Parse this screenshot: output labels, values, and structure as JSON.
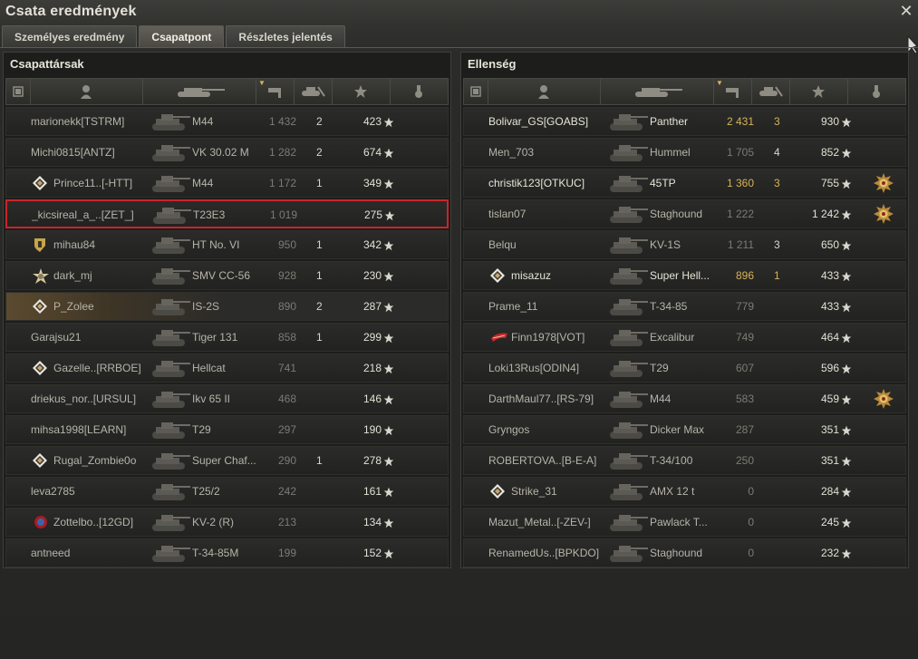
{
  "window": {
    "title": "Csata eredmények",
    "close_icon": "close-icon"
  },
  "tabs": [
    {
      "label": "Személyes eredmény",
      "active": false
    },
    {
      "label": "Csapatpont",
      "active": true
    },
    {
      "label": "Részletes jelentés",
      "active": false
    }
  ],
  "columns": [
    "squad-icon",
    "player-icon",
    "tank-icon",
    "xp-flag-icon",
    "kills-tank-icon",
    "star-icon",
    "medal-icon"
  ],
  "allies": {
    "title": "Csapattársak",
    "rows": [
      {
        "name": "marionekk[TSTRM]",
        "tank": "M44",
        "xp": "1 432",
        "kills": "2",
        "damage": "423",
        "badge": null,
        "medal": false
      },
      {
        "name": "Michi0815[ANTZ]",
        "tank": "VK 30.02 M",
        "xp": "1 282",
        "kills": "2",
        "damage": "674",
        "badge": null,
        "medal": false
      },
      {
        "name": "Prince11..[-HTT]",
        "tank": "M44",
        "xp": "1 172",
        "kills": "1",
        "damage": "349",
        "badge": "diamond",
        "medal": false
      },
      {
        "name": "_kicsireal_a_..[ZET_]",
        "tank": "T23E3",
        "xp": "1 019",
        "kills": "",
        "damage": "275",
        "badge": null,
        "medal": false,
        "highlight": true
      },
      {
        "name": "mihau84",
        "tank": "HT No. VI",
        "xp": "950",
        "kills": "1",
        "damage": "342",
        "badge": "shield",
        "medal": false
      },
      {
        "name": "dark_mj",
        "tank": "SMV CC-56",
        "xp": "928",
        "kills": "1",
        "damage": "230",
        "badge": "star-burst",
        "medal": false
      },
      {
        "name": "P_Zolee",
        "tank": "IS-2S",
        "xp": "890",
        "kills": "2",
        "damage": "287",
        "badge": "diamond",
        "medal": false,
        "squad": true
      },
      {
        "name": "Garajsu21",
        "tank": "Tiger 131",
        "xp": "858",
        "kills": "1",
        "damage": "299",
        "badge": null,
        "medal": false
      },
      {
        "name": "Gazelle..[RRBOE]",
        "tank": "Hellcat",
        "xp": "741",
        "kills": "",
        "damage": "218",
        "badge": "diamond",
        "medal": false
      },
      {
        "name": "driekus_nor..[URSUL]",
        "tank": "Ikv 65 II",
        "xp": "468",
        "kills": "",
        "damage": "146",
        "badge": null,
        "medal": false
      },
      {
        "name": "mihsa1998[LEARN]",
        "tank": "T29",
        "xp": "297",
        "kills": "",
        "damage": "190",
        "badge": null,
        "medal": false
      },
      {
        "name": "Rugal_Zombie0o",
        "tank": "Super Chaf...",
        "xp": "290",
        "kills": "1",
        "damage": "278",
        "badge": "diamond",
        "medal": false
      },
      {
        "name": "leva2785",
        "tank": "T25/2",
        "xp": "242",
        "kills": "",
        "damage": "161",
        "badge": null,
        "medal": false
      },
      {
        "name": "Zottelbo..[12GD]",
        "tank": "KV-2 (R)",
        "xp": "213",
        "kills": "",
        "damage": "134",
        "badge": "clan-red",
        "medal": false
      },
      {
        "name": "antneed",
        "tank": "T-34-85M",
        "xp": "199",
        "kills": "",
        "damage": "152",
        "badge": null,
        "medal": false
      }
    ]
  },
  "enemies": {
    "title": "Ellenség",
    "rows": [
      {
        "name": "Bolivar_GS[GOABS]",
        "tank": "Panther",
        "xp": "2 431",
        "kills": "3",
        "damage": "930",
        "badge": null,
        "medal": false,
        "bold": true
      },
      {
        "name": "Men_703",
        "tank": "Hummel",
        "xp": "1 705",
        "kills": "4",
        "damage": "852",
        "badge": null,
        "medal": false
      },
      {
        "name": "christik123[OTKUC]",
        "tank": "45TP",
        "xp": "1 360",
        "kills": "3",
        "damage": "755",
        "badge": null,
        "medal": true,
        "bold": true
      },
      {
        "name": "tislan07",
        "tank": "Staghound",
        "xp": "1 222",
        "kills": "",
        "damage": "1 242",
        "badge": null,
        "medal": true
      },
      {
        "name": "Belqu",
        "tank": "KV-1S",
        "xp": "1 211",
        "kills": "3",
        "damage": "650",
        "badge": null,
        "medal": false
      },
      {
        "name": "misazuz",
        "tank": "Super Hell...",
        "xp": "896",
        "kills": "1",
        "damage": "433",
        "badge": "diamond",
        "medal": false,
        "bold": true
      },
      {
        "name": "Prame_11",
        "tank": "T-34-85",
        "xp": "779",
        "kills": "",
        "damage": "433",
        "badge": null,
        "medal": false
      },
      {
        "name": "Finn1978[VOT]",
        "tank": "Excalibur",
        "xp": "749",
        "kills": "",
        "damage": "464",
        "badge": "clan-flag",
        "medal": false
      },
      {
        "name": "Loki13Rus[ODIN4]",
        "tank": "T29",
        "xp": "607",
        "kills": "",
        "damage": "596",
        "badge": null,
        "medal": false
      },
      {
        "name": "DarthMaul77..[RS-79]",
        "tank": "M44",
        "xp": "583",
        "kills": "",
        "damage": "459",
        "badge": null,
        "medal": true
      },
      {
        "name": "Gryngos",
        "tank": "Dicker Max",
        "xp": "287",
        "kills": "",
        "damage": "351",
        "badge": null,
        "medal": false
      },
      {
        "name": "ROBERTOVA..[B-E-A]",
        "tank": "T-34/100",
        "xp": "250",
        "kills": "",
        "damage": "351",
        "badge": null,
        "medal": false
      },
      {
        "name": "Strike_31",
        "tank": "AMX 12 t",
        "xp": "0",
        "kills": "",
        "damage": "284",
        "badge": "diamond",
        "medal": false
      },
      {
        "name": "Mazut_Metal..[-ZEV-]",
        "tank": "Pawlack T...",
        "xp": "0",
        "kills": "",
        "damage": "245",
        "badge": null,
        "medal": false
      },
      {
        "name": "RenamedUs..[BPKDO]",
        "tank": "Staghound",
        "xp": "0",
        "kills": "",
        "damage": "232",
        "badge": null,
        "medal": false
      }
    ]
  },
  "colors": {
    "highlight_border": "#c8252a",
    "gold_text": "#d8b25a",
    "panel_bg": "#1d1d1b"
  }
}
